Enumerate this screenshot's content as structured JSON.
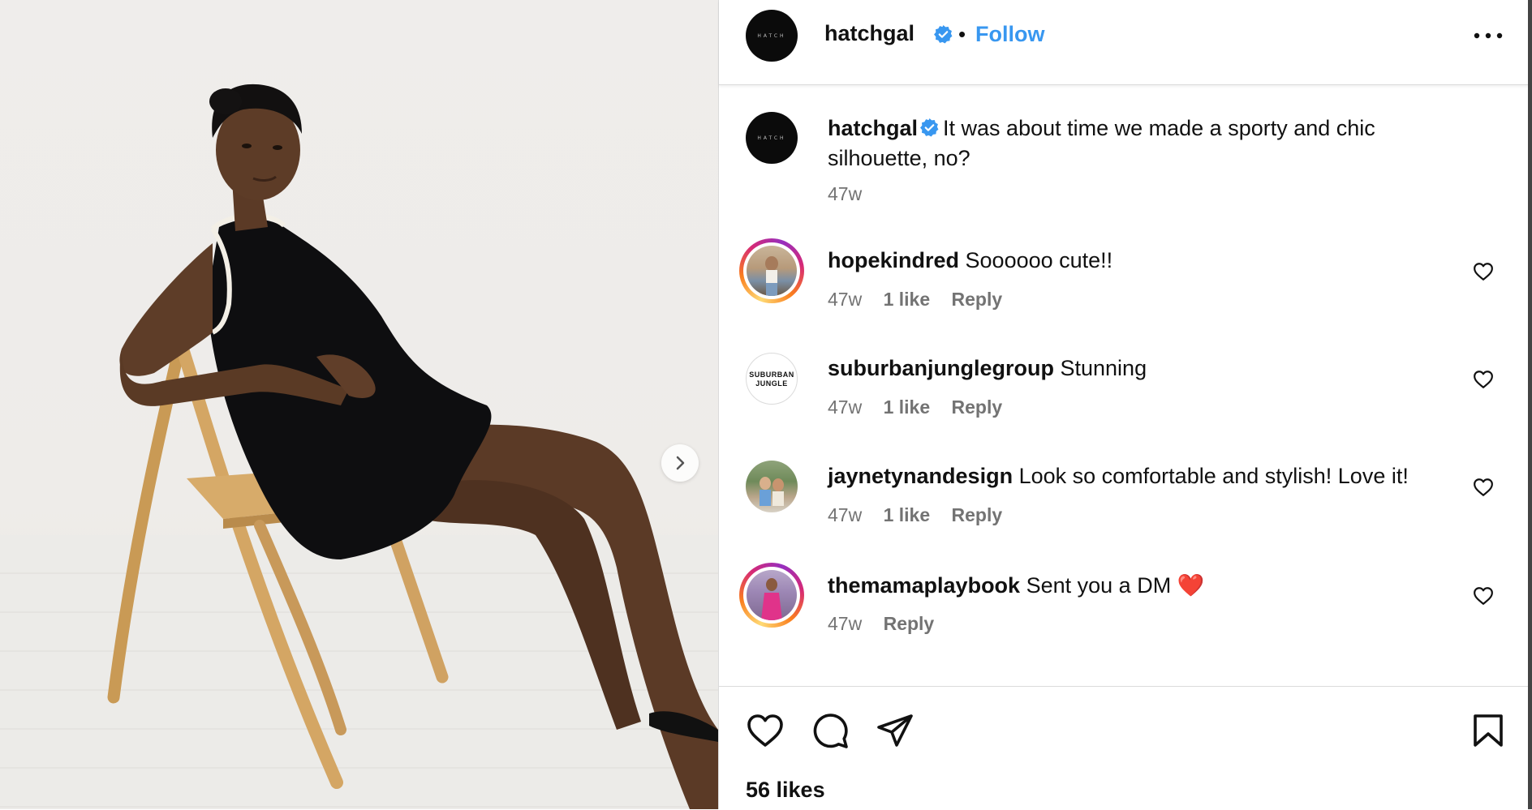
{
  "post": {
    "username": "hatchgal",
    "avatar_text": "HATCH",
    "separator": "•",
    "follow_label": "Follow",
    "caption": "It was about time we made a sporty and chic silhouette, no?",
    "caption_time": "47w",
    "likes": "56 likes"
  },
  "comments": [
    {
      "username": "hopekindred",
      "text": "Soooooo cute!!",
      "time": "47w",
      "likes": "1 like",
      "reply": "Reply",
      "ring": true
    },
    {
      "username": "suburbanjunglegroup",
      "text": "Stunning",
      "time": "47w",
      "likes": "1 like",
      "reply": "Reply",
      "ring": false,
      "avatar_text": "SUBURBAN JUNGLE"
    },
    {
      "username": "jaynetynandesign",
      "text": "Look so comfortable and stylish! Love it!",
      "time": "47w",
      "likes": "1 like",
      "reply": "Reply",
      "ring": false
    },
    {
      "username": "themamaplaybook",
      "text": "Sent you a DM ❤️",
      "time": "47w",
      "reply": "Reply",
      "ring": true
    }
  ],
  "colors": {
    "accent": "#3897f0",
    "verified": "#3897f0",
    "muted_text": "#737373",
    "divider": "#dbdbdb"
  },
  "icons": [
    "verified-badge-icon",
    "more-options-icon",
    "heart-icon",
    "comment-icon",
    "share-icon",
    "bookmark-icon",
    "chevron-right-icon"
  ]
}
